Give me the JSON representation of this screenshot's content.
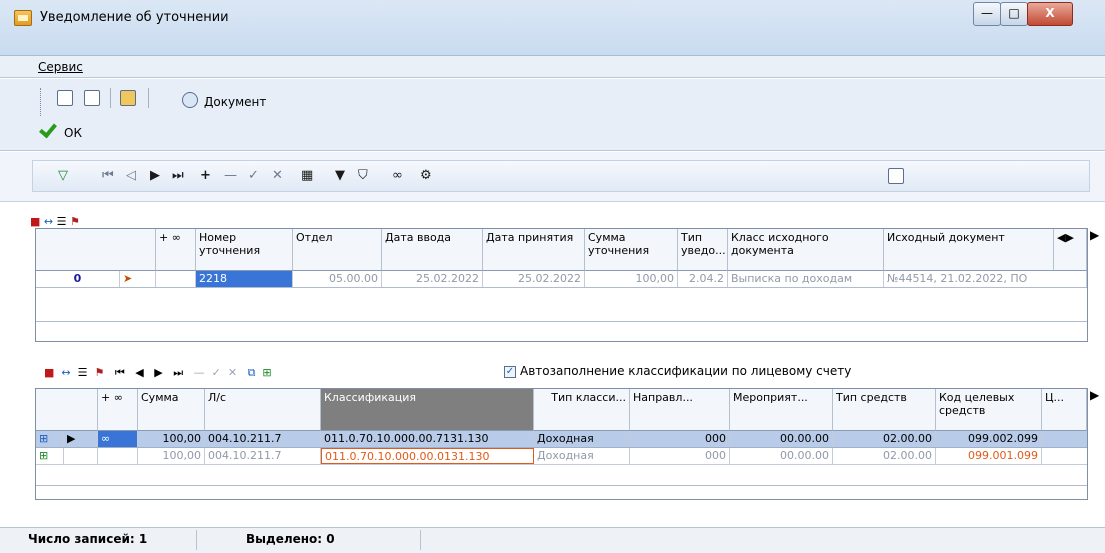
{
  "window": {
    "title": "Уведомление об уточнении",
    "minimize": "—",
    "maximize": "□",
    "close": "X"
  },
  "menu": {
    "service": "Сервис"
  },
  "toolbar": {
    "document_label": "Документ",
    "ok_label": "ОК"
  },
  "nav_glyphs": [
    "▽",
    "⏮",
    "◁",
    "▶",
    "⏭",
    "+",
    "—",
    "✓",
    "✕",
    "▦",
    "▼",
    "⛉",
    "∞",
    "⚙"
  ],
  "grid1": {
    "headers": [
      "Номер уточнения",
      "Отдел",
      "Дата ввода",
      "Дата принятия",
      "Сумма уточнения",
      "Тип уведо...",
      "Класс исходного документа",
      "Исходный документ"
    ],
    "row": {
      "indicator": "0",
      "number": "2218",
      "dept": "05.00.00",
      "date_in": "25.02.2022",
      "date_acc": "25.02.2022",
      "sum": "100,00",
      "type": "2.04.2",
      "class": "Выписка по доходам",
      "source": "№44514, 21.02.2022, ПО"
    }
  },
  "autofill_label": "Автозаполнение классификации по лицевому счету",
  "grid2": {
    "headers": [
      "Сумма",
      "Л/с",
      "Классификация",
      "Тип класси...",
      "Направл...",
      "Мероприят...",
      "Тип средств",
      "Код целевых средств",
      "Ц..."
    ],
    "rows": [
      {
        "sum": "100,00",
        "account": "004.10.211.7",
        "class": "011.0.70.10.000.00.7131.130",
        "type": "Доходная",
        "dir": "000",
        "event": "00.00.00",
        "funds": "02.00.00",
        "code": "099.002.099"
      },
      {
        "sum": "100,00",
        "account": "004.10.211.7",
        "class": "011.0.70.10.000.00.0131.130",
        "type": "Доходная",
        "dir": "000",
        "event": "00.00.00",
        "funds": "02.00.00",
        "code": "099.001.099"
      }
    ]
  },
  "status": {
    "count_label": "Число записей:",
    "count_value": "1",
    "selected_label": "Выделено:",
    "selected_value": "0"
  },
  "colors": {
    "selection": "#3875d7",
    "row_highlight": "#b8cbe8",
    "orange_text": "#e05a1a"
  }
}
